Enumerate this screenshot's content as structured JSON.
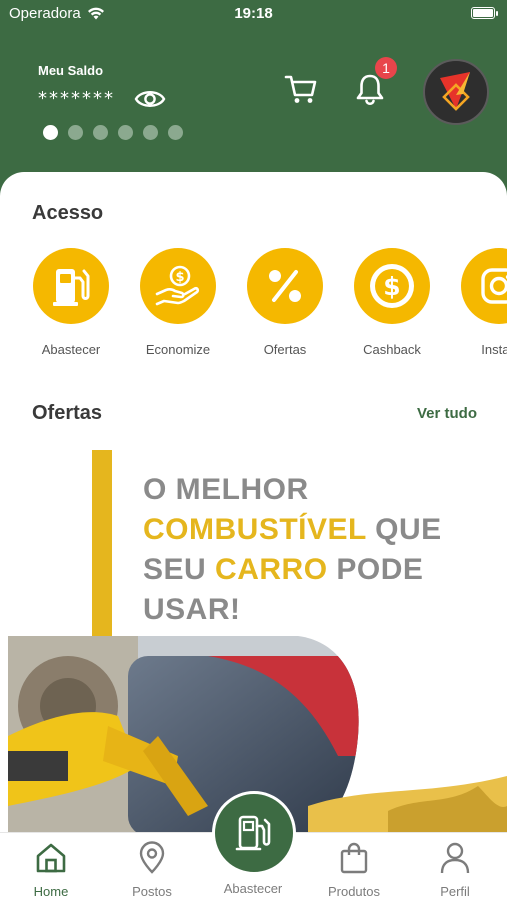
{
  "status_bar": {
    "carrier": "Operadora",
    "time": "19:18"
  },
  "header": {
    "balance_label": "Meu Saldo",
    "balance_value": "*******",
    "notification_count": "1",
    "page_indicator": {
      "count": 6,
      "active": 0
    }
  },
  "access": {
    "title": "Acesso",
    "items": [
      {
        "label": "Abastecer",
        "icon": "fuel-pump-icon"
      },
      {
        "label": "Economize",
        "icon": "hand-coin-icon"
      },
      {
        "label": "Ofertas",
        "icon": "percent-icon"
      },
      {
        "label": "Cashback",
        "icon": "dollar-coin-icon"
      },
      {
        "label": "Instag",
        "icon": "instagram-icon"
      }
    ]
  },
  "offers": {
    "title": "Ofertas",
    "see_all": "Ver tudo",
    "banner": {
      "line1": "O MELHOR",
      "line2_highlight": "COMBUSTÍVEL",
      "line2_rest": " QUE",
      "line3_start": "SEU ",
      "line3_highlight": "CARRO",
      "line3_rest": " PODE",
      "line4": "USAR!"
    }
  },
  "bottom_nav": {
    "items": [
      {
        "label": "Home",
        "icon": "home-icon",
        "active": true
      },
      {
        "label": "Postos",
        "icon": "map-pin-icon"
      },
      {
        "label": "Abastecer",
        "icon": "fuel-pump-icon"
      },
      {
        "label": "Produtos",
        "icon": "shopping-bag-icon"
      },
      {
        "label": "Perfil",
        "icon": "user-icon"
      }
    ]
  },
  "colors": {
    "brand_green": "#3d6b43",
    "accent_yellow": "#f5b800",
    "badge_red": "#e8454b"
  }
}
